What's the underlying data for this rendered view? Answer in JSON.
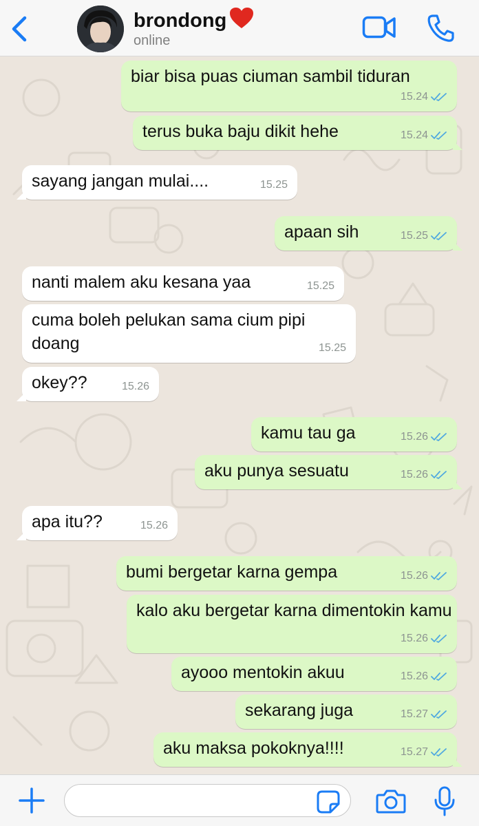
{
  "header": {
    "contact_name": "brondong",
    "name_emoji_icon": "red-heart-icon",
    "status": "online",
    "icons": [
      "chevron-left-icon",
      "video-camera-icon",
      "phone-icon"
    ]
  },
  "colors": {
    "accent": "#1a7cf5",
    "outgoing_bubble": "#dcf8c6",
    "incoming_bubble": "#ffffff",
    "read_ticks": "#4fa8e0",
    "chat_background": "#ece5dd"
  },
  "messages": [
    {
      "direction": "out",
      "text": "biar bisa puas ciuman sambil tiduran",
      "time": "15.24",
      "status": "read"
    },
    {
      "direction": "out",
      "text": "terus buka baju dikit hehe",
      "time": "15.24",
      "status": "read"
    },
    {
      "direction": "in",
      "text": "sayang jangan mulai....",
      "time": "15.25"
    },
    {
      "direction": "out",
      "text": "apaan sih",
      "time": "15.25",
      "status": "read"
    },
    {
      "direction": "in",
      "text": "nanti malem aku kesana yaa",
      "time": "15.25"
    },
    {
      "direction": "in",
      "text": "cuma boleh pelukan sama cium pipi doang",
      "time": "15.25"
    },
    {
      "direction": "in",
      "text": "okey??",
      "time": "15.26"
    },
    {
      "direction": "out",
      "text": "kamu tau ga",
      "time": "15.26",
      "status": "read"
    },
    {
      "direction": "out",
      "text": "aku punya sesuatu",
      "time": "15.26",
      "status": "read"
    },
    {
      "direction": "in",
      "text": "apa itu??",
      "time": "15.26"
    },
    {
      "direction": "out",
      "text": "bumi bergetar karna gempa",
      "time": "15.26",
      "status": "read"
    },
    {
      "direction": "out",
      "text": "kalo aku bergetar karna dimentokin kamu",
      "time": "15.26",
      "status": "read"
    },
    {
      "direction": "out",
      "text": "ayooo mentokin akuu",
      "time": "15.26",
      "status": "read"
    },
    {
      "direction": "out",
      "text": "sekarang juga",
      "time": "15.27",
      "status": "read"
    },
    {
      "direction": "out",
      "text": "aku maksa pokoknya!!!!",
      "time": "15.27",
      "status": "read"
    }
  ],
  "input_bar": {
    "message_value": "",
    "icons": [
      "plus-icon",
      "sticker-icon",
      "camera-icon",
      "microphone-icon"
    ]
  }
}
